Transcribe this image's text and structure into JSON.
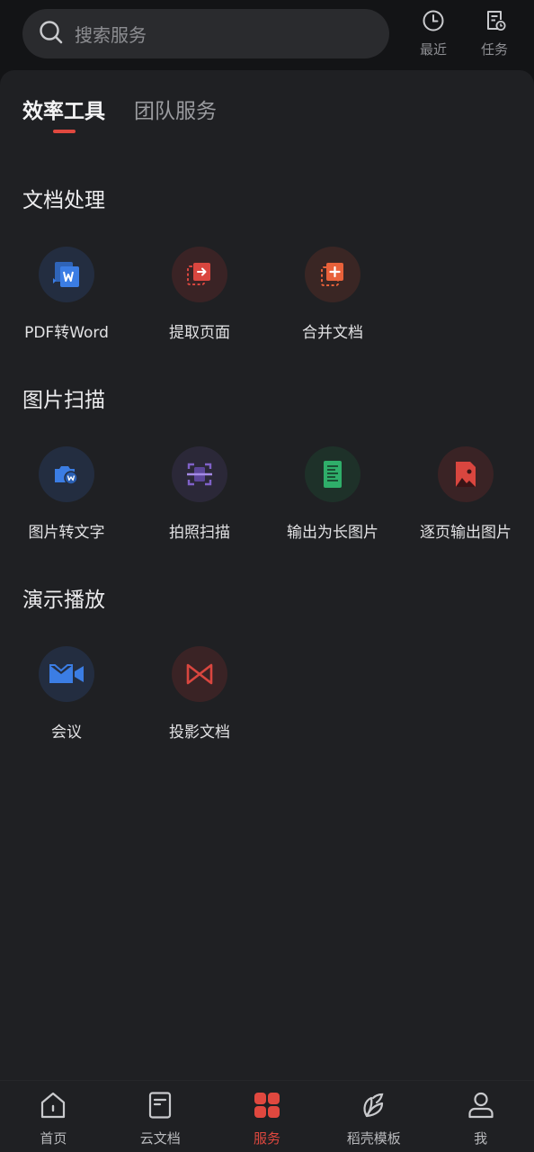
{
  "search": {
    "placeholder": "搜索服务"
  },
  "top_actions": [
    {
      "label": "最近",
      "icon": "clock-icon"
    },
    {
      "label": "任务",
      "icon": "task-list-icon"
    }
  ],
  "tabs": [
    {
      "label": "效率工具",
      "active": true
    },
    {
      "label": "团队服务",
      "active": false
    }
  ],
  "sections": [
    {
      "title": "文档处理",
      "tools": [
        {
          "label": "PDF转Word",
          "icon": "pdf-to-word-icon"
        },
        {
          "label": "提取页面",
          "icon": "extract-page-icon"
        },
        {
          "label": "合并文档",
          "icon": "merge-doc-icon"
        }
      ]
    },
    {
      "title": "图片扫描",
      "tools": [
        {
          "label": "图片转文字",
          "icon": "image-to-text-icon"
        },
        {
          "label": "拍照扫描",
          "icon": "scan-icon"
        },
        {
          "label": "输出为长图片",
          "icon": "long-image-icon"
        },
        {
          "label": "逐页输出图片",
          "icon": "page-image-icon"
        }
      ]
    },
    {
      "title": "演示播放",
      "tools": [
        {
          "label": "会议",
          "icon": "meeting-icon"
        },
        {
          "label": "投影文档",
          "icon": "projection-icon"
        }
      ]
    }
  ],
  "bottom_nav": [
    {
      "label": "首页",
      "icon": "home-icon",
      "active": false
    },
    {
      "label": "云文档",
      "icon": "cloud-doc-icon",
      "active": false
    },
    {
      "label": "服务",
      "icon": "apps-grid-icon",
      "active": true
    },
    {
      "label": "稻壳模板",
      "icon": "leaf-icon",
      "active": false
    },
    {
      "label": "我",
      "icon": "user-icon",
      "active": false
    }
  ],
  "colors": {
    "accent": "#e0483f",
    "blue": "#3b7de4",
    "red": "#d9463f",
    "orange": "#e8613a",
    "purple": "#7f61c8",
    "green": "#2fae6a"
  }
}
